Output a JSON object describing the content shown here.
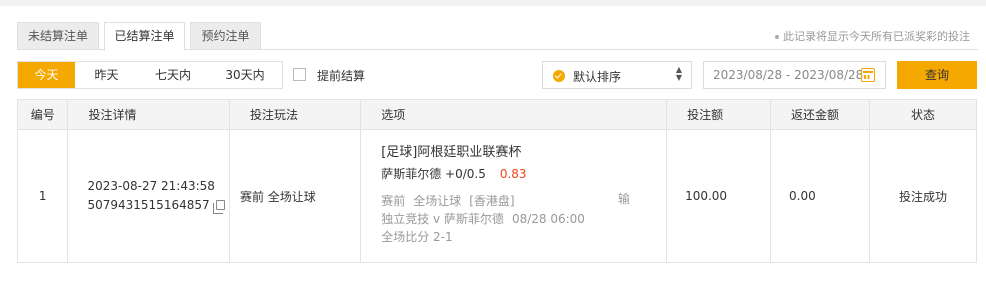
{
  "tabs": [
    {
      "label": "未结算注单",
      "active": false
    },
    {
      "label": "已结算注单",
      "active": true
    },
    {
      "label": "预约注单",
      "active": false
    }
  ],
  "note": "此记录将显示今天所有已派奖彩的投注",
  "filters": {
    "ranges": [
      "今天",
      "昨天",
      "七天内",
      "30天内"
    ],
    "selected": "今天",
    "early_settle_label": "提前结算",
    "sort_label": "默认排序",
    "date_range": "2023/08/28 - 2023/08/28",
    "query_label": "查询"
  },
  "table": {
    "headers": [
      "编号",
      "投注详情",
      "投注玩法",
      "选项",
      "投注额",
      "返还金额",
      "状态"
    ],
    "rows": [
      {
        "no": "1",
        "datetime": "2023-08-27 21:43:58",
        "order_id": "5079431515164857",
        "play": "赛前 全场让球",
        "league": "[足球]阿根廷职业联赛杯",
        "selection": "萨斯菲尔德 +0/0.5",
        "odds": "0.83",
        "market": "赛前",
        "market_type": "全场让球",
        "odds_format": "[香港盘]",
        "match": "独立竞技 v 萨斯菲尔德",
        "match_time": "08/28 06:00",
        "score": "全场比分 2-1",
        "result": "输",
        "stake": "100.00",
        "return": "0.00",
        "status": "投注成功"
      }
    ]
  },
  "colors": {
    "accent": "#f5a800",
    "odds": "#e8491d"
  },
  "icons": [
    "check-circle-icon",
    "sort-arrows-icon",
    "calendar-icon",
    "copy-icon"
  ]
}
